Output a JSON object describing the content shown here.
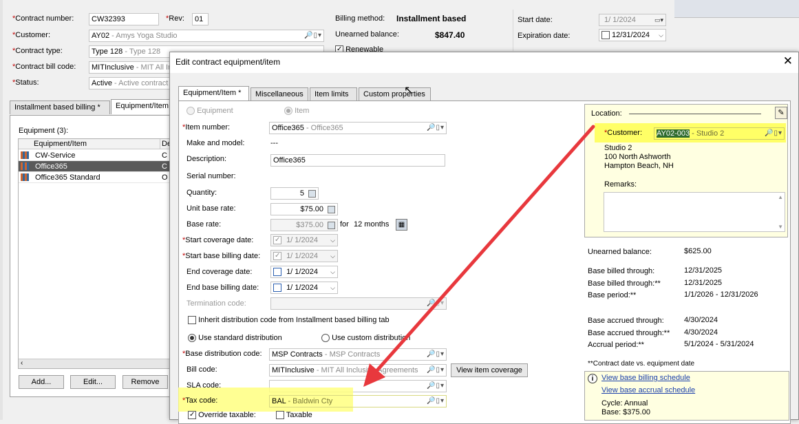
{
  "contract": {
    "contract_number_label": "Contract number:",
    "contract_number": "CW32393",
    "rev_label": "Rev:",
    "rev": "01",
    "customer_label": "Customer:",
    "customer_code": "AY02",
    "customer_desc": "- Amys Yoga Studio",
    "contract_type_label": "Contract type:",
    "contract_type_code": "Type 128",
    "contract_type_desc": "- Type 128",
    "bill_code_label": "Contract bill code:",
    "bill_code_code": "MITInclusive",
    "bill_code_desc": "- MIT All Inc",
    "status_label": "Status:",
    "status_code": "Active",
    "status_desc": "- Active contract",
    "billing_method_label": "Billing method:",
    "billing_method": "Installment based",
    "unearned_balance_label": "Unearned balance:",
    "unearned_balance": "$847.40",
    "renewable_label": "Renewable",
    "start_date_label": "Start date:",
    "start_date": "1/  1/2024",
    "expiration_date_label": "Expiration date:",
    "expiration_date": "12/31/2024"
  },
  "bg_tabs": [
    "Installment based billing *",
    "Equipment/Item"
  ],
  "equipment": {
    "count_label": "Equipment (3):",
    "col_item": "Equipment/Item",
    "col_desc": "De",
    "rows": [
      {
        "name": "CW-Service",
        "desc": "C"
      },
      {
        "name": "Office365",
        "desc": "C"
      },
      {
        "name": "Office365 Standard",
        "desc": "O"
      }
    ],
    "add_label": "Add...",
    "edit_label": "Edit...",
    "remove_label": "Remove"
  },
  "dialog": {
    "title": "Edit contract equipment/item",
    "tabs": [
      "Equipment/Item *",
      "Miscellaneous",
      "Item limits",
      "Custom properties"
    ],
    "equipment_radio": "Equipment",
    "item_radio": "Item",
    "item_number_label": "Item number:",
    "item_number_code": "Office365",
    "item_number_desc": "- Office365",
    "make_model_label": "Make and model:",
    "make_model": "---",
    "description_label": "Description:",
    "description": "Office365",
    "serial_label": "Serial number:",
    "quantity_label": "Quantity:",
    "quantity": "5",
    "unit_rate_label": "Unit base rate:",
    "unit_rate": "$75.00",
    "base_rate_label": "Base rate:",
    "base_rate": "$375.00",
    "for_label": "for",
    "months": "12 months",
    "start_coverage_label": "Start coverage date:",
    "start_coverage": "1/  1/2024",
    "start_billing_label": "Start base billing date:",
    "start_billing": "1/  1/2024",
    "end_coverage_label": "End coverage date:",
    "end_coverage": "1/  1/2024",
    "end_billing_label": "End base billing date:",
    "end_billing": "1/  1/2024",
    "termination_label": "Termination code:",
    "inherit_label": "Inherit distribution code from Installment based billing tab",
    "use_standard_label": "Use standard distribution",
    "use_custom_label": "Use custom distribution",
    "base_dist_label": "Base distribution code:",
    "base_dist_code": "MSP Contracts",
    "base_dist_desc": "- MSP Contracts",
    "bill_code_label": "Bill code:",
    "bill_code_code": "MITInclusive",
    "bill_code_desc": "- MIT All Inclusive Agreements",
    "view_coverage_label": "View item coverage",
    "sla_label": "SLA code:",
    "tax_label": "Tax code:",
    "tax_code": "BAL",
    "tax_desc": "- Baldwin Cty",
    "override_taxable_label": "Override taxable:",
    "taxable_label": "Taxable",
    "location": {
      "title": "Location:",
      "customer_label": "Customer:",
      "customer_code": "AY02-003",
      "customer_desc": "- Studio 2",
      "address": [
        "Studio 2",
        "100 North Ashworth",
        "Hampton Beach, NH"
      ],
      "remarks_label": "Remarks:"
    },
    "summary": [
      {
        "label": "Unearned balance:",
        "value": "$625.00"
      },
      {
        "label": "Base billed through:",
        "value": "12/31/2025"
      },
      {
        "label": "Base billed through:**",
        "value": "12/31/2025"
      },
      {
        "label": "Base period:**",
        "value": "1/1/2026 - 12/31/2026"
      },
      {
        "label": "Base accrued through:",
        "value": "4/30/2024"
      },
      {
        "label": "Base accrued through:**",
        "value": "4/30/2024"
      },
      {
        "label": "Accrual period:**",
        "value": "5/1/2024 - 5/31/2024"
      }
    ],
    "footnote": "**Contract date vs. equipment date",
    "info": {
      "billing_link": "View base billing schedule",
      "accrual_link": "View base accrual schedule",
      "cycle": "Cycle: Annual",
      "base": "Base: $375.00"
    }
  },
  "colors": {
    "highlight": "#ffff80",
    "arrow": "#e8383d",
    "selection": "#5a5a5a",
    "location_bg": "#ffffe1"
  }
}
